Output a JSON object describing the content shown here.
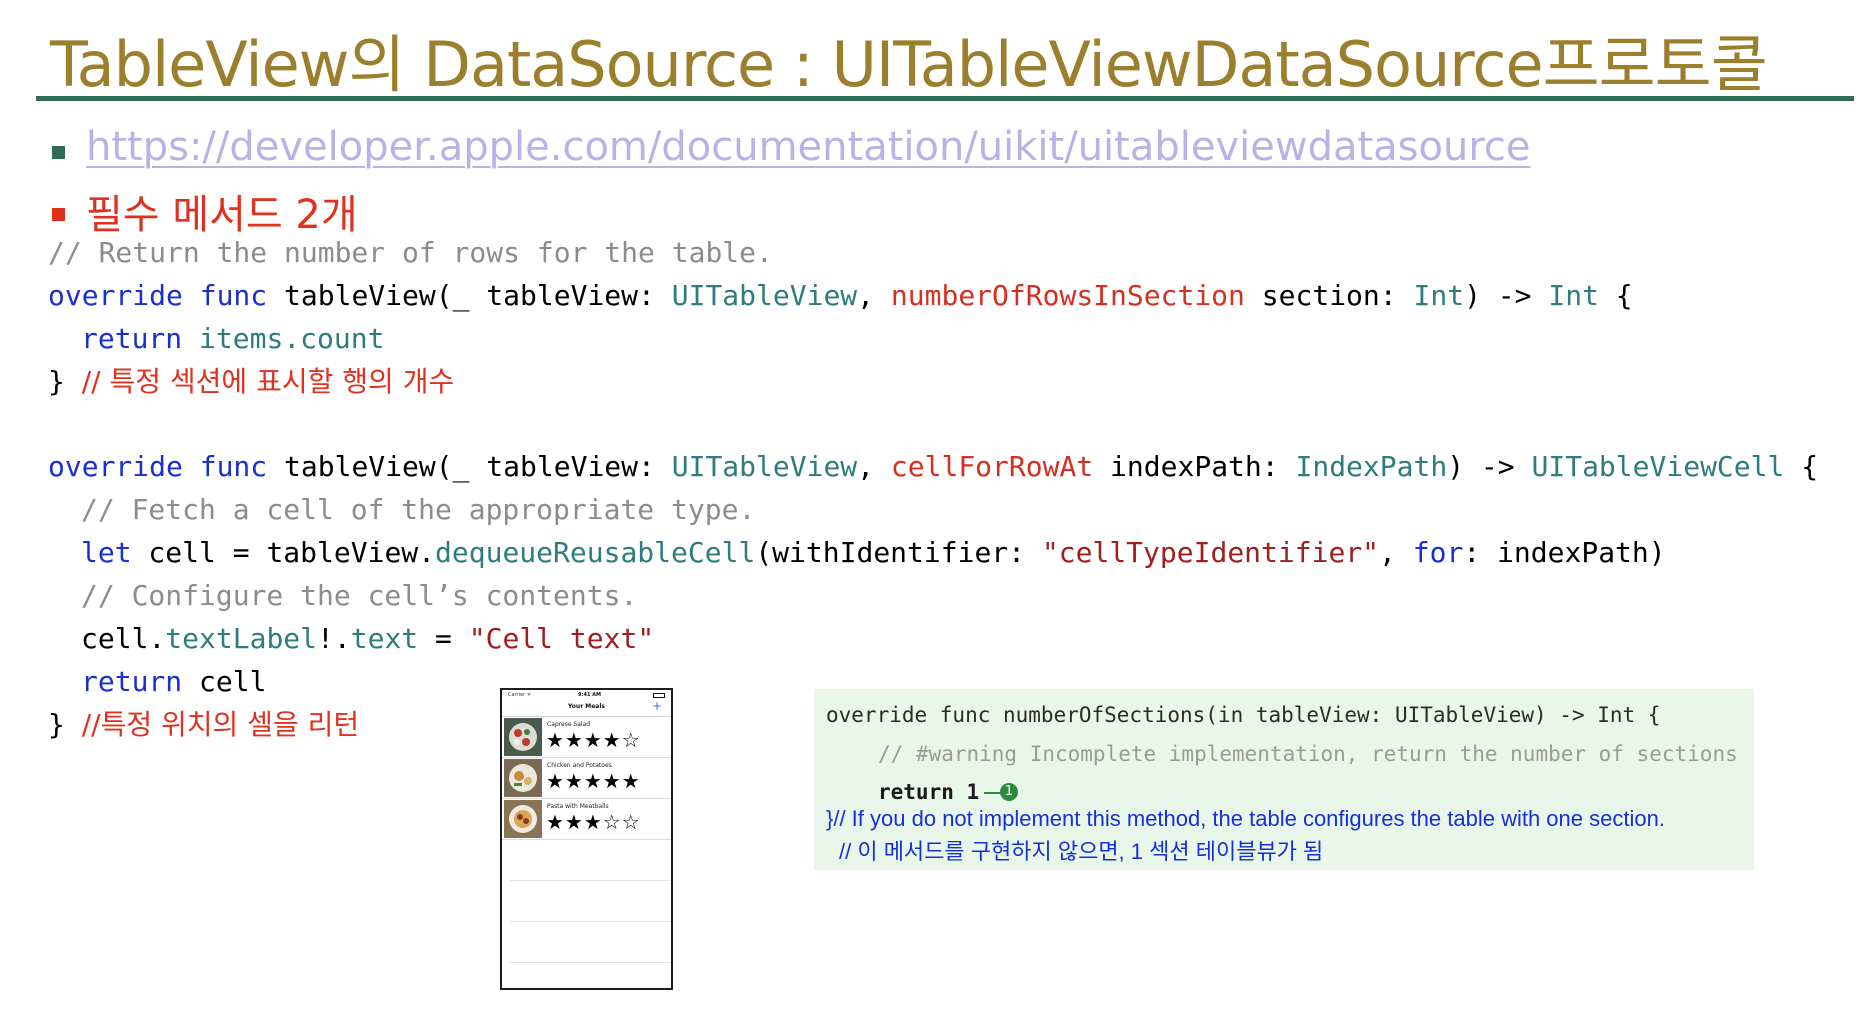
{
  "slide": {
    "title": "TableView의 DataSource : UITableViewDataSource프로토콜",
    "link": "https://developer.apple.com/documentation/uikit/uitableviewdatasource",
    "required_methods": "필수 메서드 2개"
  },
  "code": {
    "comment1": "// Return the number of rows for the table.",
    "override": "override",
    "func": "func",
    "tableView_open": " tableView(_ tableView: ",
    "type_uitableview": "UITableView",
    "comma": ", ",
    "label_rows": "numberOfRowsInSection",
    "param_section": " section: ",
    "type_int": "Int",
    "arrow": ") -> ",
    "brace_open": " {",
    "return": "return",
    "items": "items",
    "dot": ".",
    "count": "count",
    "brace_close": "}",
    "korean_comment1": "// 특정 섹션에 표시할 행의 개수",
    "label_cell": "cellForRowAt",
    "param_indexpath": " indexPath: ",
    "type_indexpath": "IndexPath",
    "type_cell": "UITableViewCell",
    "comment2": "// Fetch a cell of the appropriate type.",
    "let": "let",
    "cell_eq": " cell = tableView.",
    "dequeue": "dequeueReusableCell",
    "with_identifier": "(withIdentifier: ",
    "identifier_string": "\"cellTypeIdentifier\"",
    "for": "for",
    "for_arg": ": indexPath)",
    "comment3": "// Configure the cell’s contents.",
    "cell": "cell",
    "textLabel": "textLabel",
    "bang_dot": "!.",
    "text": "text",
    "assign": " = ",
    "cell_text_string": "\"Cell text\"",
    "return_cell_tail": " cell",
    "korean_comment2": "//특정 위치의 셀을 리턴"
  },
  "phone": {
    "carrier": "Carrier ᯤ",
    "time": "9:41 AM",
    "nav_title": "Your Meals",
    "add_symbol": "+",
    "meals": [
      {
        "name": "Caprese Salad",
        "rating": 4,
        "stars_text": "★★★★☆"
      },
      {
        "name": "Chicken and Potatoes",
        "rating": 5,
        "stars_text": "★★★★★"
      },
      {
        "name": "Pasta with Meatballs",
        "rating": 3,
        "stars_text": "★★★☆☆"
      }
    ]
  },
  "panel": {
    "signature": "override func numberOfSections(in tableView: UITableView) -> Int {",
    "warning": "// #warning Incomplete implementation, return the number of sections",
    "return_line": "return 1",
    "badge": "1",
    "note_en": "}// If you do not implement this method, the table configures the table with one section.",
    "note_ko": "// 이 메서드를 구현하지 않으면, 1 섹션 테이블뷰가 됨"
  },
  "colors": {
    "title": "#9b7f2c",
    "rule": "#2f6b56",
    "keyword": "#1b2fd0",
    "type": "#2e7c7e",
    "label": "#d52f21",
    "comment": "#8c8c8c",
    "panel_bg": "#e9f6ea",
    "panel_note": "#1530d6"
  }
}
